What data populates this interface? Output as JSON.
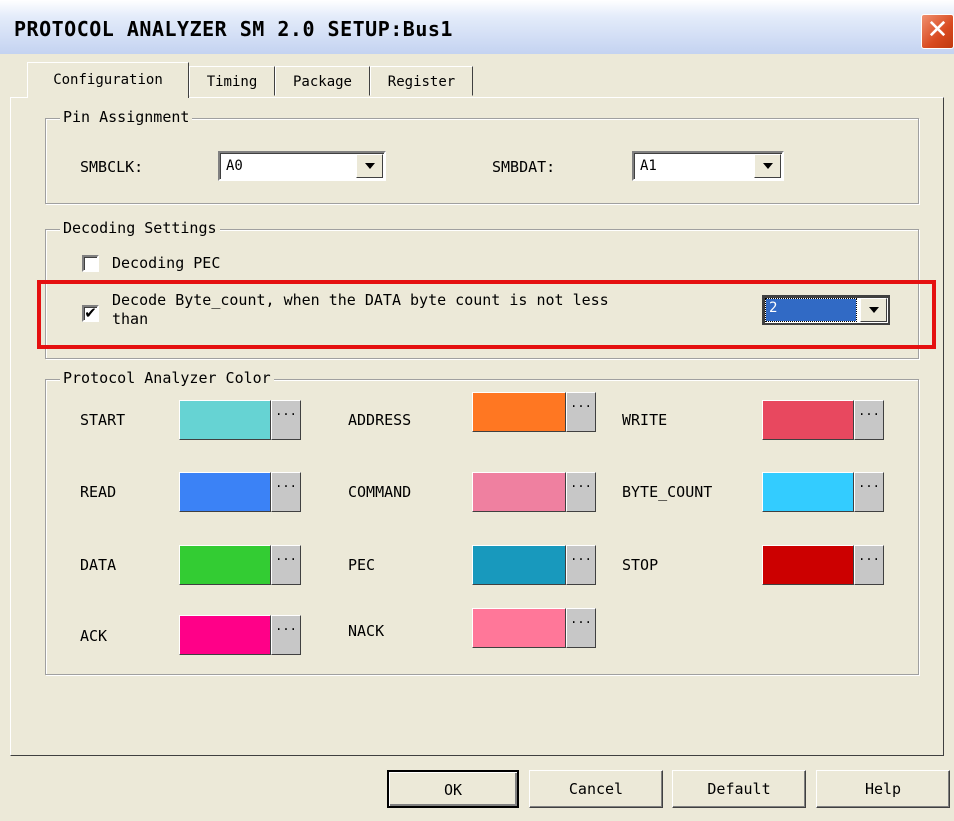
{
  "window": {
    "title": "PROTOCOL ANALYZER SM 2.0 SETUP:Bus1",
    "close_glyph": "✕"
  },
  "tabs": [
    {
      "label": "Configuration",
      "active": true
    },
    {
      "label": "Timing",
      "active": false
    },
    {
      "label": "Package",
      "active": false
    },
    {
      "label": "Register",
      "active": false
    }
  ],
  "pin_assignment": {
    "legend": "Pin Assignment",
    "smbclk_label": "SMBCLK:",
    "smbclk_value": "A0",
    "smbdat_label": "SMBDAT:",
    "smbdat_value": "A1"
  },
  "decoding": {
    "legend": "Decoding Settings",
    "pec_label": "Decoding PEC",
    "pec_checked": false,
    "byte_count_label_line1": "Decode Byte_count, when the DATA byte count is not less",
    "byte_count_label_line2": "than",
    "byte_count_checked": true,
    "byte_count_check_glyph": "✔",
    "byte_count_value": "2"
  },
  "colors": {
    "legend": "Protocol Analyzer Color",
    "ellipsis": "...",
    "items": [
      {
        "label": "START",
        "color": "#66d3d3"
      },
      {
        "label": "ADDRESS",
        "color": "#ff7722"
      },
      {
        "label": "WRITE",
        "color": "#e8485f"
      },
      {
        "label": "READ",
        "color": "#3b82f6"
      },
      {
        "label": "COMMAND",
        "color": "#ef80a0"
      },
      {
        "label": "BYTE_COUNT",
        "color": "#33ccff"
      },
      {
        "label": "DATA",
        "color": "#33cc33"
      },
      {
        "label": "PEC",
        "color": "#1899bd"
      },
      {
        "label": "STOP",
        "color": "#cc0000"
      },
      {
        "label": "ACK",
        "color": "#ff0088"
      },
      {
        "label": "NACK",
        "color": "#ff7799"
      }
    ]
  },
  "buttons": {
    "ok": "OK",
    "cancel": "Cancel",
    "default": "Default",
    "help": "Help"
  },
  "theme": {
    "highlight_color": "#e51010",
    "selection_color": "#316ac5"
  }
}
